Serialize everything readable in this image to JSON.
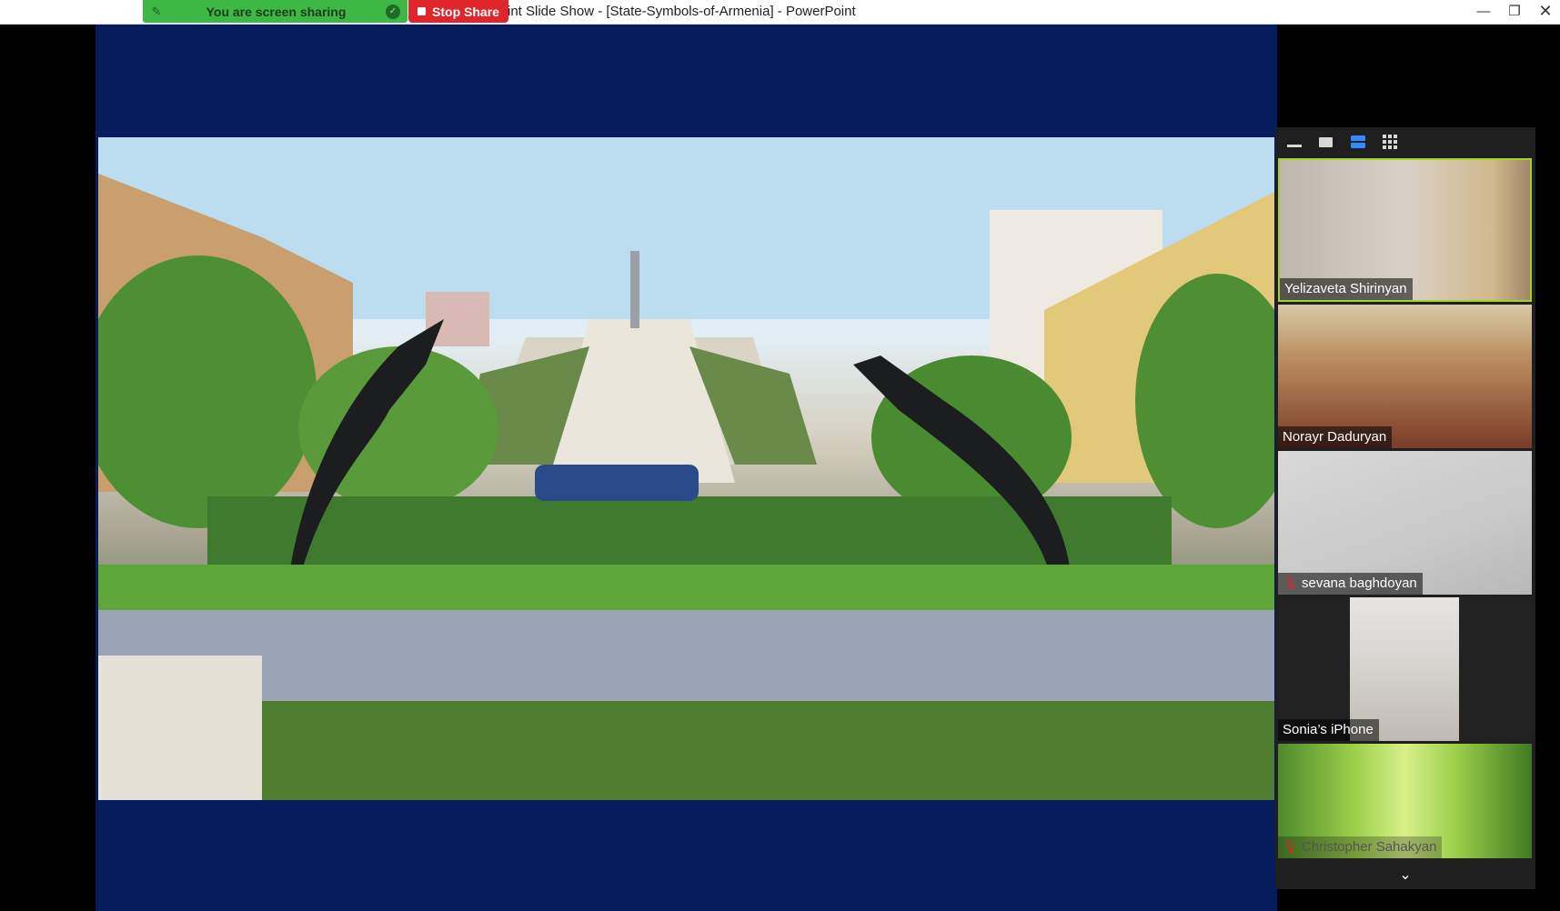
{
  "window": {
    "title": "int Slide Show - [State-Symbols-of-Armenia] - PowerPoint",
    "controls": {
      "minimize": "—",
      "restore": "❐",
      "close": "✕"
    }
  },
  "share_bar": {
    "status": "You are screen sharing",
    "stop_label": "Stop Share",
    "accent": "#3db844",
    "stop_color": "#e0262b"
  },
  "slide": {
    "background": "#061c5c",
    "photo_subject": "Cascade complex with horse sculptures"
  },
  "panel": {
    "view_buttons": [
      "minimize-icon",
      "single-video-icon",
      "speaker-view-icon",
      "gallery-view-icon"
    ],
    "participants": [
      {
        "name": "Yelizaveta Shirinyan",
        "muted": false,
        "active_speaker": true
      },
      {
        "name": "Norayr Daduryan",
        "muted": false,
        "active_speaker": false
      },
      {
        "name": "sevana baghdoyan",
        "muted": true,
        "active_speaker": false
      },
      {
        "name": "Sonia’s iPhone",
        "muted": false,
        "active_speaker": false
      },
      {
        "name": "Christopher Sahakyan",
        "muted": true,
        "active_speaker": false
      }
    ],
    "scroll_icon": "chevron-down-icon"
  }
}
